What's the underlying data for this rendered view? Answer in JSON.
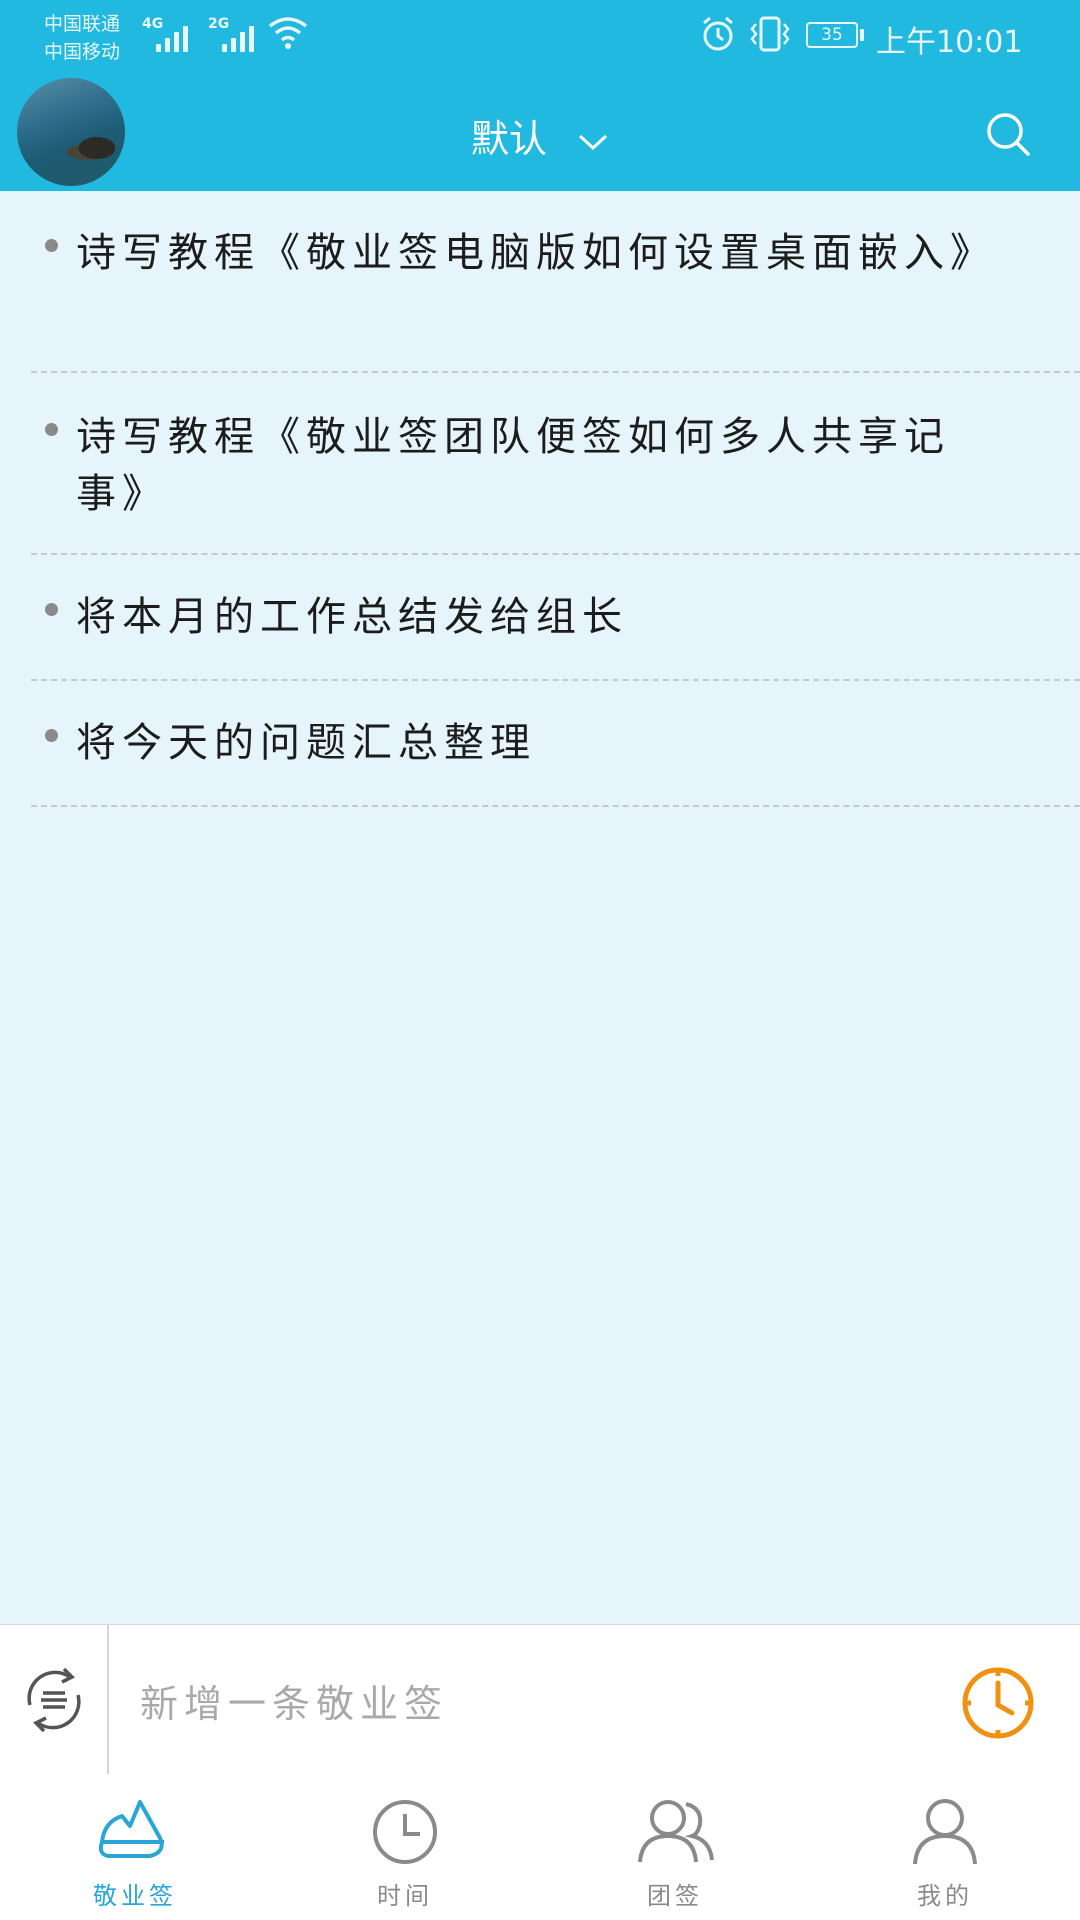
{
  "status_bar": {
    "carrier_1": "中国联通",
    "carrier_2": "中国移动",
    "network_1": "4G",
    "network_2": "2G",
    "battery": "35",
    "time": "上午10:01"
  },
  "header": {
    "title": "默认",
    "icons": [
      "avatar",
      "chevron-down-icon",
      "search-icon"
    ]
  },
  "notes": [
    {
      "text": "诗写教程《敬业签电脑版如何设置桌面嵌入》"
    },
    {
      "text": "诗写教程《敬业签团队便签如何多人共享记事》"
    },
    {
      "text": "将本月的工作总结发给组长"
    },
    {
      "text": "将今天的问题汇总整理"
    }
  ],
  "input_bar": {
    "placeholder": "新增一条敬业签",
    "icons": [
      "list-toggle-icon",
      "clock-reminder-icon"
    ],
    "accent_color": "#f0920f"
  },
  "tabs": [
    {
      "label": "敬业签",
      "icon": "note-tab-icon",
      "active": true
    },
    {
      "label": "时间",
      "icon": "clock-icon",
      "active": false
    },
    {
      "label": "团签",
      "icon": "team-icon",
      "active": false
    },
    {
      "label": "我的",
      "icon": "profile-icon",
      "active": false
    }
  ],
  "colors": {
    "header": "#22b9e0",
    "background": "#e6f5fb",
    "active_tab": "#2aa6d6",
    "inactive_tab": "#8a8a8a"
  }
}
